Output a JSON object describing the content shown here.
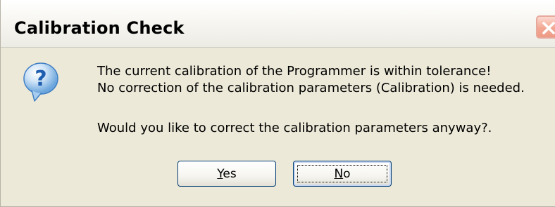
{
  "window": {
    "title": "Calibration Check",
    "close_icon": "close-icon"
  },
  "message": {
    "icon": "question-icon",
    "line1": "The current calibration of the Programmer is within tolerance!",
    "line2": "No correction of the calibration parameters (Calibration) is needed.",
    "line3": "Would you like to correct the calibration parameters anyway?."
  },
  "buttons": {
    "yes": {
      "mnemonic": "Y",
      "rest": "es"
    },
    "no": {
      "mnemonic": "N",
      "rest": "o"
    }
  },
  "colors": {
    "dialog_background": "#ece9d8",
    "button_border": "#003c74",
    "close_button": "#ee9a85",
    "icon_blue": "#2f7fd0"
  }
}
